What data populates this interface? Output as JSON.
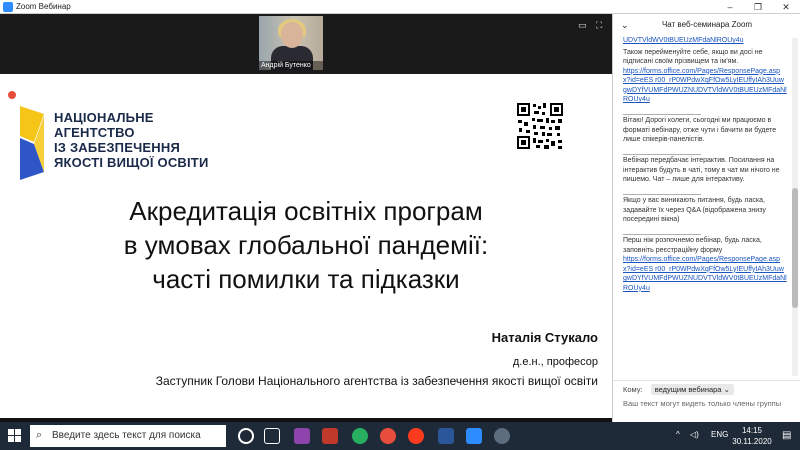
{
  "window": {
    "title": "Zoom Вебинар"
  },
  "participant": {
    "name": "Андрій Бутенко"
  },
  "slide": {
    "logo_lines": [
      "НАЦІОНАЛЬНЕ",
      "АГЕНТСТВО",
      "ІЗ ЗАБЕЗПЕЧЕННЯ",
      "ЯКОСТІ ВИЩОЇ ОСВІТИ"
    ],
    "title_lines": [
      "Акредитація освітніх програм",
      "в умовах глобальної пандемії:",
      "часті помилки та підказки"
    ],
    "author": "Наталія Стукало",
    "degree": "д.е.н., професор",
    "position": "Заступник Голови Національного агентства із забезпечення якості вищої освіти"
  },
  "chat": {
    "header": "Чат веб-семинара Zoom",
    "messages": [
      {
        "text": "",
        "link": "UDVTVldWV0tBUEUzMFdaNlROUy4u",
        "sep": ""
      },
      {
        "text": "Також перейменуйте себе, якщо ви досі не підписані своїм прізвищем та ім'ям.",
        "link": "https://forms.office.com/Pages/ResponsePage.aspx?id=eES r00_rP0WPdwXqFfOw5LyIEUffyIAh3UuwgwDYfVUMFdPWUZNUDVTVldWV0tBUEUzMFdaNlROUy4u",
        "sep": ""
      },
      {
        "text": "Вітаю! Дорогі колеги, сьогодні ми працюємо в форматі вебінару, отже чути і бачити ви будете лише спікерів-панелістів.",
        "link": "",
        "sep": "____________________"
      },
      {
        "text": "Вебінар передбачає інтерактив. Посилання на інтерактив будуть в чаті, тому в чат ми нічого не пишемо. Чат – лише для інтерактиву.",
        "link": "",
        "sep": "____________________"
      },
      {
        "text": "Якщо у вас виникають питання, будь ласка, задавайте їх через Q&A (відображена знизу посередині вікна)",
        "link": "",
        "sep": "____________________"
      },
      {
        "text": "Перш ніж розпочнемо вебінар, будь ласка, заповніть реєстраційну форму",
        "link": "https://forms.office.com/Pages/ResponsePage.aspx?id=eES r00_rP0WPdwXqFfOw5LyIEUffyIAh3UuwgwDYfVUMFdPWUZNUDVTVldWV0tBUEUzMFdaNlROUy4u",
        "sep": "____________________"
      }
    ],
    "to_label": "Кому:",
    "to_value": "ведущим вебинара",
    "hint": "Ваш текст могут видеть только члены группы"
  },
  "taskbar": {
    "search_placeholder": "Введите здесь текст для поиска",
    "lang": "ENG",
    "time": "14:15",
    "date": "30.11.2020"
  },
  "colors": {
    "accent_blue": "#2d8cff",
    "logo_yellow": "#f5c518",
    "logo_blue": "#2f56c7",
    "link_blue": "#1a55c0"
  }
}
